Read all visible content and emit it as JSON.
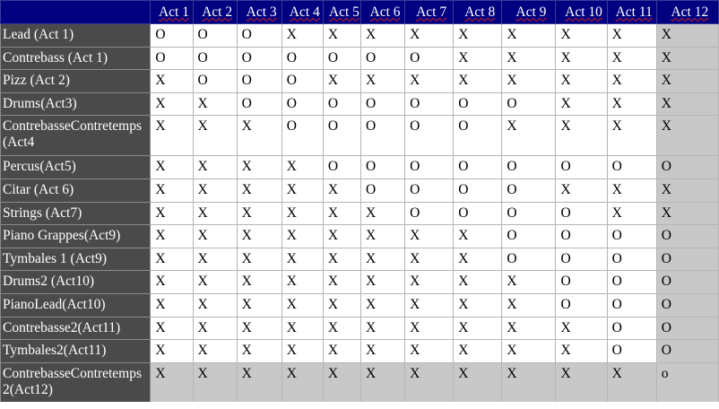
{
  "columns": [
    "Act 1",
    "Act 2",
    "Act 3",
    "Act 4",
    "Act 5",
    "Act 6",
    "Act 7",
    "Act 8",
    "Act 9",
    "Act 10",
    "Act 11",
    "Act 12"
  ],
  "rows": [
    {
      "label": "Lead (Act 1)",
      "cells": [
        "O",
        "O",
        "O",
        "X",
        "X",
        "X",
        "X",
        "X",
        "X",
        "X",
        "X",
        "X"
      ]
    },
    {
      "label": "Contrebass (Act 1)",
      "cells": [
        "O",
        "O",
        "O",
        "O",
        "O",
        "O",
        "O",
        "X",
        "X",
        "X",
        "X",
        "X"
      ]
    },
    {
      "label": "Pizz (Act 2)",
      "cells": [
        "X",
        "O",
        "O",
        "O",
        "X",
        "X",
        "X",
        "X",
        "X",
        "X",
        "X",
        "X"
      ]
    },
    {
      "label": "Drums(Act3)",
      "cells": [
        "X",
        "X",
        "O",
        "O",
        "O",
        "O",
        "O",
        "O",
        "O",
        "X",
        "X",
        "X"
      ]
    },
    {
      "label": "ContrebasseContretemps (Act4",
      "cells": [
        "X",
        "X",
        "X",
        "O",
        "O",
        "O",
        "O",
        "O",
        "X",
        "X",
        "X",
        "X"
      ]
    },
    {
      "label": "Percus(Act5)",
      "cells": [
        "X",
        "X",
        "X",
        "X",
        "O",
        "O",
        "O",
        "O",
        "O",
        "O",
        "O",
        "O"
      ]
    },
    {
      "label": "Citar (Act 6)",
      "cells": [
        "X",
        "X",
        "X",
        "X",
        "X",
        "O",
        "O",
        "O",
        "O",
        "X",
        "X",
        "X"
      ]
    },
    {
      "label": "Strings (Act7)",
      "cells": [
        "X",
        "X",
        "X",
        "X",
        "X",
        "X",
        "O",
        "O",
        "O",
        "O",
        "X",
        "X"
      ]
    },
    {
      "label": "Piano Grappes(Act9)",
      "cells": [
        "X",
        "X",
        "X",
        "X",
        "X",
        "X",
        "X",
        "X",
        "O",
        "O",
        "O",
        "O"
      ]
    },
    {
      "label": "Tymbales 1 (Act9)",
      "cells": [
        "X",
        "X",
        "X",
        "X",
        "X",
        "X",
        "X",
        "X",
        "O",
        "O",
        "O",
        "O"
      ]
    },
    {
      "label": "Drums2 (Act10)",
      "cells": [
        "X",
        "X",
        "X",
        "X",
        "X",
        "X",
        "X",
        "X",
        "X",
        "O",
        "O",
        "O"
      ]
    },
    {
      "label": "PianoLead(Act10)",
      "cells": [
        "X",
        "X",
        "X",
        "X",
        "X",
        "X",
        "X",
        "X",
        "X",
        "O",
        "O",
        "O"
      ]
    },
    {
      "label": "Contrebasse2(Act11)",
      "cells": [
        "X",
        "X",
        "X",
        "X",
        "X",
        "X",
        "X",
        "X",
        "X",
        "X",
        "O",
        "O"
      ]
    },
    {
      "label": "Tymbales2(Act11)",
      "cells": [
        "X",
        "X",
        "X",
        "X",
        "X",
        "X",
        "X",
        "X",
        "X",
        "X",
        "O",
        "O"
      ]
    },
    {
      "label": "ContrebasseContretemps 2(Act12)",
      "cells": [
        "X",
        "X",
        "X",
        "X",
        "X",
        "X",
        "X",
        "X",
        "X",
        "X",
        "X",
        "o"
      ]
    }
  ],
  "colors": {
    "header_bg": "#000080",
    "row_header_bg": "#4a4a4a",
    "shaded_cell_bg": "#c8c8c8",
    "spellcheck_underline": "#dd2222"
  }
}
